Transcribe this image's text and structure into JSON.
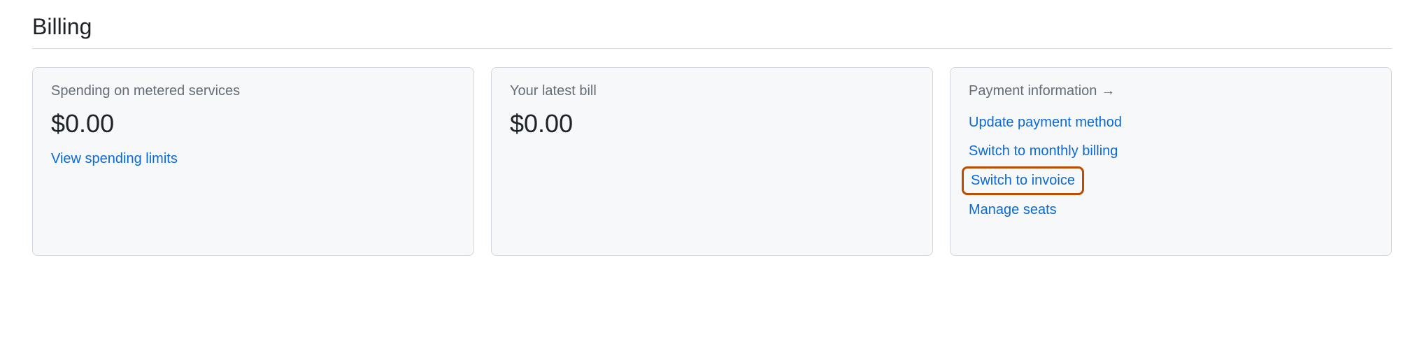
{
  "page": {
    "title": "Billing"
  },
  "cards": {
    "spending": {
      "heading": "Spending on metered services",
      "amount": "$0.00",
      "link": "View spending limits"
    },
    "latest_bill": {
      "heading": "Your latest bill",
      "amount": "$0.00"
    },
    "payment_info": {
      "heading": "Payment information",
      "arrow": "→",
      "links": {
        "update_payment": "Update payment method",
        "switch_monthly": "Switch to monthly billing",
        "switch_invoice": "Switch to invoice",
        "manage_seats": "Manage seats"
      }
    }
  }
}
